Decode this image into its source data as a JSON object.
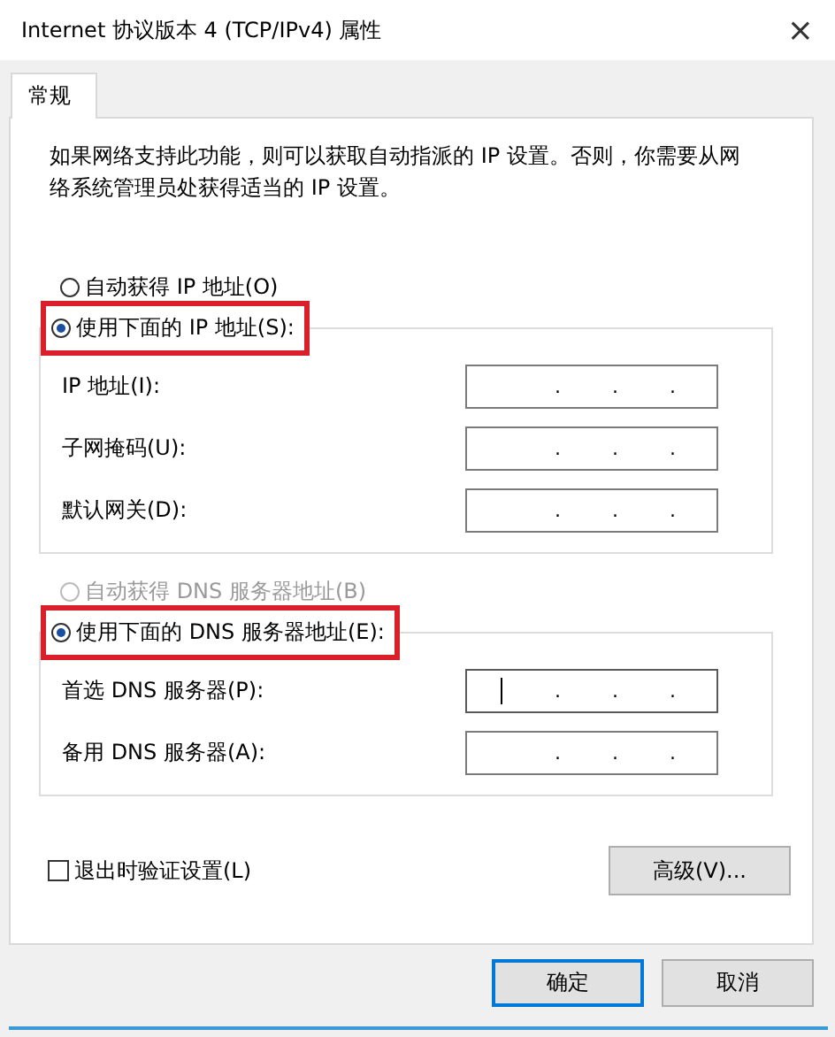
{
  "window": {
    "title": "Internet 协议版本 4 (TCP/IPv4) 属性",
    "close": "×"
  },
  "tabs": [
    {
      "label": "常规",
      "selected": true
    }
  ],
  "description": "如果网络支持此功能，则可以获取自动指派的 IP 设置。否则，你需要从网络系统管理员处获得适当的 IP 设置。",
  "ip_auto": {
    "label": "自动获得 IP 地址(O)",
    "selected": false,
    "disabled": false,
    "highlighted": false
  },
  "ip_manual": {
    "label": "使用下面的 IP 地址(S):",
    "selected": true,
    "disabled": false,
    "highlighted": true
  },
  "ip_fields": [
    {
      "label": "IP 地址(I):",
      "dots": [
        ".",
        ".",
        "."
      ],
      "focused": false
    },
    {
      "label": "子网掩码(U):",
      "dots": [
        ".",
        ".",
        "."
      ],
      "focused": false
    },
    {
      "label": "默认网关(D):",
      "dots": [
        ".",
        ".",
        "."
      ],
      "focused": false
    }
  ],
  "dns_auto": {
    "label": "自动获得 DNS 服务器地址(B)",
    "selected": false,
    "disabled": true,
    "highlighted": false
  },
  "dns_manual": {
    "label": "使用下面的 DNS 服务器地址(E):",
    "selected": true,
    "disabled": false,
    "highlighted": true
  },
  "dns_fields": [
    {
      "label": "首选 DNS 服务器(P):",
      "dots": [
        ".",
        ".",
        "."
      ],
      "focused": true
    },
    {
      "label": "备用 DNS 服务器(A):",
      "dots": [
        ".",
        ".",
        "."
      ],
      "focused": false
    }
  ],
  "validate": {
    "label": "退出时验证设置(L)",
    "checked": false
  },
  "advanced_button": "高级(V)...",
  "buttons": [
    {
      "label": "确定",
      "default": true
    },
    {
      "label": "取消",
      "default": false
    }
  ]
}
